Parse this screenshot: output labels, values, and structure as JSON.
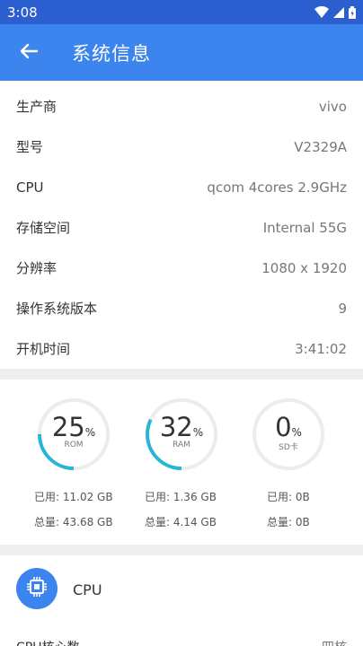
{
  "status_bar": {
    "time": "3:08"
  },
  "app_bar": {
    "title": "系统信息"
  },
  "info_rows": [
    {
      "label": "生产商",
      "value": "vivo"
    },
    {
      "label": "型号",
      "value": "V2329A"
    },
    {
      "label": "CPU",
      "value": "qcom 4cores 2.9GHz"
    },
    {
      "label": "存储空间",
      "value": "Internal 55G"
    },
    {
      "label": "分辨率",
      "value": "1080 x 1920"
    },
    {
      "label": "操作系统版本",
      "value": "9"
    },
    {
      "label": "开机时间",
      "value": "3:41:02"
    }
  ],
  "storage": {
    "rom": {
      "percent": "25",
      "pct_sign": "%",
      "label": "ROM",
      "used": "已用: 11.02 GB",
      "total": "总量: 43.68 GB",
      "fraction": 0.25
    },
    "ram": {
      "percent": "32",
      "pct_sign": "%",
      "label": "RAM",
      "used": "已用: 1.36 GB",
      "total": "总量: 4.14 GB",
      "fraction": 0.32
    },
    "sd": {
      "percent": "0",
      "pct_sign": "%",
      "label": "SD卡",
      "used": "已用: 0B",
      "total": "总量: 0B",
      "fraction": 0.0
    }
  },
  "cpu_section": {
    "title": "CPU",
    "first_row_label": "CPU核心数",
    "first_row_value": "四核"
  },
  "colors": {
    "status_bar": "#2b5fd0",
    "app_bar": "#3d85ee",
    "gauge_arc": "#29b6d6",
    "gauge_track": "#ececec"
  }
}
